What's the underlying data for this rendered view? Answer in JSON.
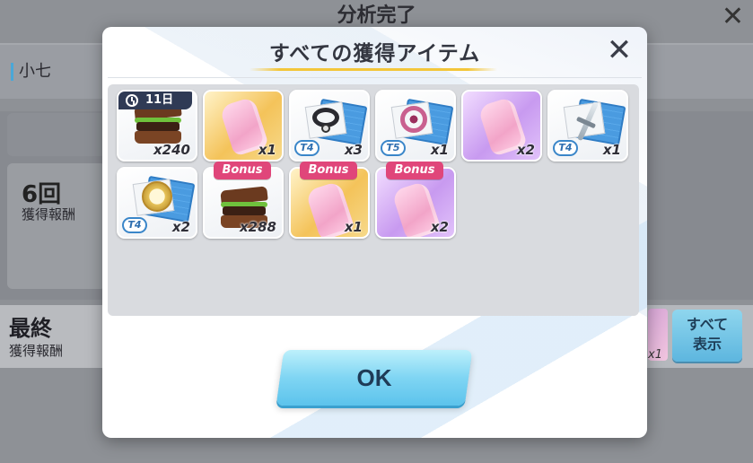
{
  "background": {
    "title": "分析完了",
    "close_symbol": "✕",
    "name_label": "小七",
    "count_value": "6回",
    "count_label": "獲得報酬",
    "final_value": "最終",
    "final_label": "獲得報酬",
    "right_qty": "x1",
    "show_all_line1": "すべて",
    "show_all_line2": "表示"
  },
  "modal": {
    "title": "すべての獲得アイテム",
    "close_symbol": "✕",
    "ok_label": "OK",
    "accent_color": "#f3c63a"
  },
  "items": [
    {
      "icon": "sandwich-icon",
      "qty": "x240",
      "timer": "11日",
      "bonus": null,
      "tier": null,
      "bg": "white"
    },
    {
      "icon": "pink-stone-icon",
      "qty": "x1",
      "timer": null,
      "bonus": null,
      "tier": null,
      "bg": "gold"
    },
    {
      "icon": "choker-blueprint-icon",
      "qty": "x3",
      "timer": null,
      "bonus": null,
      "tier": "T4",
      "bg": "white"
    },
    {
      "icon": "ring-blueprint-icon",
      "qty": "x1",
      "timer": null,
      "bonus": null,
      "tier": "T5",
      "bg": "white"
    },
    {
      "icon": "pink-stone-icon",
      "qty": "x2",
      "timer": null,
      "bonus": null,
      "tier": null,
      "bg": "purple"
    },
    {
      "icon": "sword-blueprint-icon",
      "qty": "x1",
      "timer": null,
      "bonus": null,
      "tier": "T4",
      "bg": "white"
    },
    {
      "icon": "compass-blueprint-icon",
      "qty": "x2",
      "timer": null,
      "bonus": null,
      "tier": "T4",
      "bg": "white"
    },
    {
      "icon": "sandwich-icon",
      "qty": "x288",
      "timer": null,
      "bonus": "Bonus",
      "tier": null,
      "bg": "white"
    },
    {
      "icon": "pink-stone-icon",
      "qty": "x1",
      "timer": null,
      "bonus": "Bonus",
      "tier": null,
      "bg": "gold"
    },
    {
      "icon": "pink-stone-icon",
      "qty": "x2",
      "timer": null,
      "bonus": "Bonus",
      "tier": null,
      "bg": "purple"
    }
  ]
}
